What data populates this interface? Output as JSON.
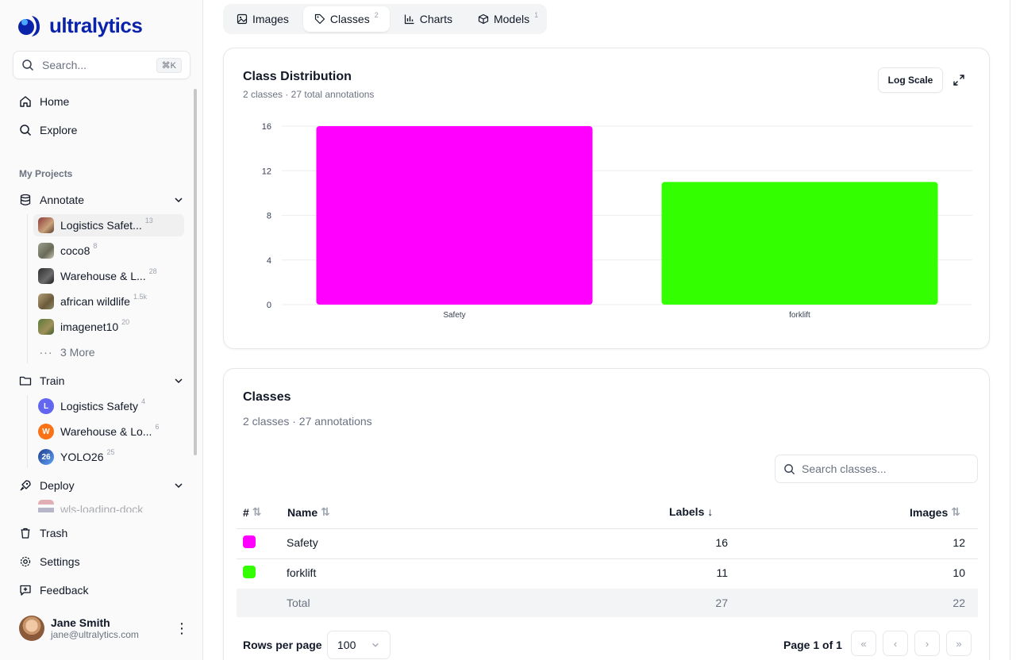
{
  "app": {
    "logo_text": "ultralytics",
    "brand_color": "#0b23a9"
  },
  "sidebar": {
    "search": {
      "placeholder": "Search...",
      "shortcut": "⌘K"
    },
    "nav": [
      {
        "label": "Home",
        "icon": "home-icon"
      },
      {
        "label": "Explore",
        "icon": "search-icon"
      }
    ],
    "section_label": "My Projects",
    "annotate": {
      "label": "Annotate",
      "items": [
        {
          "label": "Logistics Safet...",
          "count": "13",
          "active": true
        },
        {
          "label": "coco8",
          "count": "8"
        },
        {
          "label": "Warehouse & L...",
          "count": "28"
        },
        {
          "label": "african wildlife",
          "count": "1.5k"
        },
        {
          "label": "imagenet10",
          "count": "20"
        }
      ],
      "more": "3 More"
    },
    "train": {
      "label": "Train",
      "items": [
        {
          "label": "Logistics Safety",
          "count": "4",
          "avatar": "L",
          "color": "#6366f1"
        },
        {
          "label": "Warehouse & Lo...",
          "count": "6",
          "avatar": "W",
          "color": "#f97316"
        },
        {
          "label": "YOLO26",
          "count": "25",
          "avatar": "26",
          "color": "#1e3a8a"
        }
      ]
    },
    "deploy": {
      "label": "Deploy",
      "items": [
        {
          "label": "wls-loading-dock"
        }
      ]
    },
    "bottom": [
      {
        "label": "Trash"
      },
      {
        "label": "Settings"
      },
      {
        "label": "Feedback"
      }
    ],
    "user": {
      "name": "Jane Smith",
      "email": "jane@ultralytics.com"
    }
  },
  "tabs": [
    {
      "label": "Images",
      "count": ""
    },
    {
      "label": "Classes",
      "count": "2",
      "active": true
    },
    {
      "label": "Charts",
      "count": ""
    },
    {
      "label": "Models",
      "count": "1"
    }
  ],
  "distribution": {
    "title": "Class Distribution",
    "subtitle": "2 classes · 27 total annotations",
    "log_button": "Log Scale"
  },
  "chart_data": {
    "type": "bar",
    "categories": [
      "Safety",
      "forklift"
    ],
    "values": [
      16,
      11
    ],
    "colors": [
      "#ff00ff",
      "#33ff00"
    ],
    "ylim": [
      0,
      16
    ],
    "yticks": [
      0,
      4,
      8,
      12,
      16
    ],
    "grid": true,
    "title": "",
    "xlabel": "",
    "ylabel": ""
  },
  "classes": {
    "title": "Classes",
    "subtitle": "2 classes · 27 annotations",
    "search_placeholder": "Search classes...",
    "columns": {
      "index": "#",
      "name": "Name",
      "labels": "Labels",
      "images": "Images"
    },
    "rows": [
      {
        "name": "Safety",
        "color": "#ff00ff",
        "labels": "16",
        "images": "12"
      },
      {
        "name": "forklift",
        "color": "#33ff00",
        "labels": "11",
        "images": "10"
      }
    ],
    "total": {
      "label": "Total",
      "labels": "27",
      "images": "22"
    },
    "rows_per_page_label": "Rows per page",
    "rows_per_page": "100",
    "page_info": "Page 1 of 1"
  }
}
